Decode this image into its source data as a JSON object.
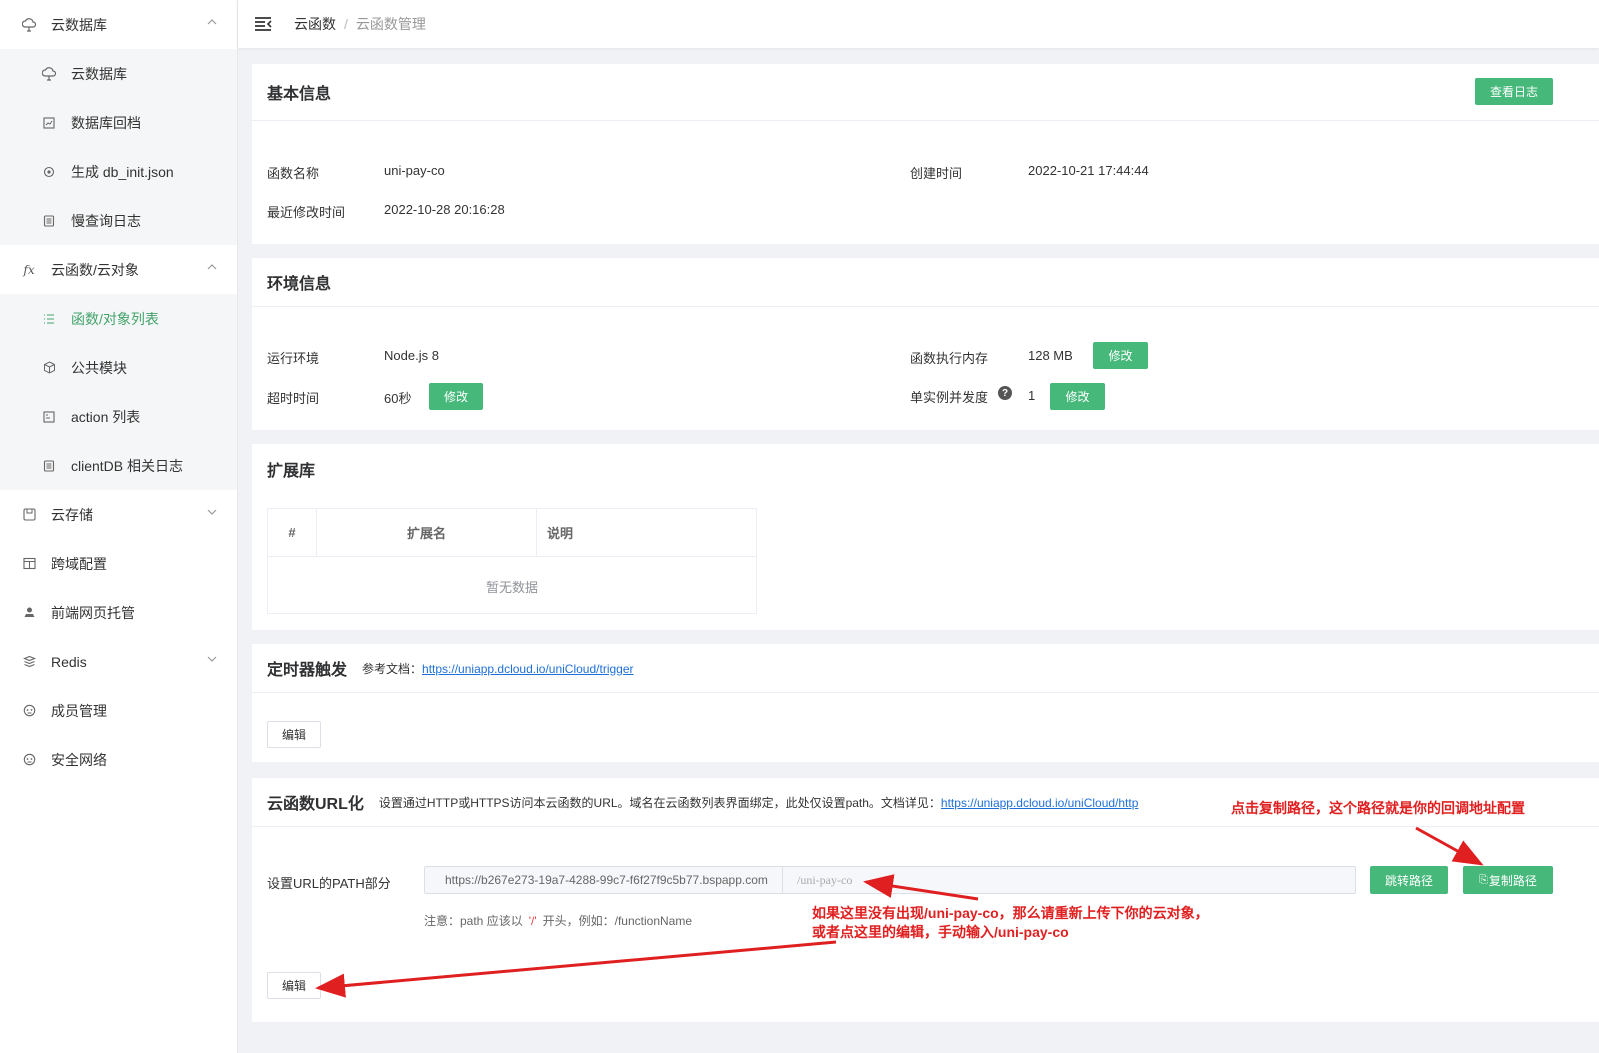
{
  "sidebar": {
    "groups": [
      {
        "label": "云数据库",
        "icon": "cloud-database-icon",
        "expanded": true,
        "items": [
          {
            "label": "云数据库",
            "icon": "cloud-database-icon"
          },
          {
            "label": "数据库回档",
            "icon": "database-rollback-icon"
          },
          {
            "label": "生成 db_init.json",
            "icon": "generate-icon"
          },
          {
            "label": "慢查询日志",
            "icon": "log-icon"
          }
        ]
      },
      {
        "label": "云函数/云对象",
        "icon": "fx-icon",
        "expanded": true,
        "items": [
          {
            "label": "函数/对象列表",
            "icon": "list-icon",
            "active": true
          },
          {
            "label": "公共模块",
            "icon": "cube-icon"
          },
          {
            "label": "action 列表",
            "icon": "action-icon"
          },
          {
            "label": "clientDB 相关日志",
            "icon": "log-icon"
          }
        ]
      },
      {
        "label": "云存储",
        "icon": "storage-icon",
        "expanded": false
      },
      {
        "label": "跨域配置",
        "icon": "cors-icon"
      },
      {
        "label": "前端网页托管",
        "icon": "hosting-icon"
      },
      {
        "label": "Redis",
        "icon": "redis-icon",
        "expanded": false
      },
      {
        "label": "成员管理",
        "icon": "member-icon"
      },
      {
        "label": "安全网络",
        "icon": "security-icon"
      }
    ]
  },
  "header": {
    "breadcrumb": [
      "云函数",
      "云函数管理"
    ],
    "separator": "/"
  },
  "basic": {
    "title": "基本信息",
    "log_button": "查看日志",
    "name_label": "函数名称",
    "name_value": "uni-pay-co",
    "created_label": "创建时间",
    "created_value": "2022-10-21 17:44:44",
    "modified_label": "最近修改时间",
    "modified_value": "2022-10-28 20:16:28"
  },
  "env": {
    "title": "环境信息",
    "runtime_label": "运行环境",
    "runtime_value": "Node.js 8",
    "memory_label": "函数执行内存",
    "memory_value": "128 MB",
    "timeout_label": "超时时间",
    "timeout_value": "60秒",
    "concurrency_label": "单实例并发度",
    "concurrency_value": "1",
    "edit_label": "修改"
  },
  "ext": {
    "title": "扩展库",
    "columns": [
      "#",
      "扩展名",
      "说明"
    ],
    "empty_text": "暂无数据"
  },
  "timer": {
    "title": "定时器触发",
    "doc_prefix": "参考文档：",
    "doc_link": "https://uniapp.dcloud.io/uniCloud/trigger",
    "edit_label": "编辑"
  },
  "url": {
    "title": "云函数URL化",
    "desc_prefix": "设置通过HTTP或HTTPS访问本云函数的URL。域名在云函数列表界面绑定，此处仅设置path。文档详见：",
    "doc_link": "https://uniapp.dcloud.io/uniCloud/http",
    "path_label": "设置URL的PATH部分",
    "domain_value": "https://b267e273-19a7-4288-99c7-f6f27f9c5b77.bspapp.com",
    "path_value": "/uni-pay-co",
    "jump_button": "跳转路径",
    "copy_button": "复制路径",
    "hint_prefix": "注意：path 应该以",
    "hint_quote": "'/'",
    "hint_suffix": "开头，例如：/functionName",
    "edit_label": "编辑"
  },
  "annotations": {
    "copy_note": "点击复制路径，这个路径就是你的回调地址配置",
    "path_note_1": "如果这里没有出现/uni-pay-co，那么请重新上传下你的云对象，",
    "path_note_2": "或者点这里的编辑，手动输入/uni-pay-co"
  },
  "colors": {
    "accent": "#45b87a",
    "annotation": "#e02020",
    "link": "#1e6fd9"
  }
}
